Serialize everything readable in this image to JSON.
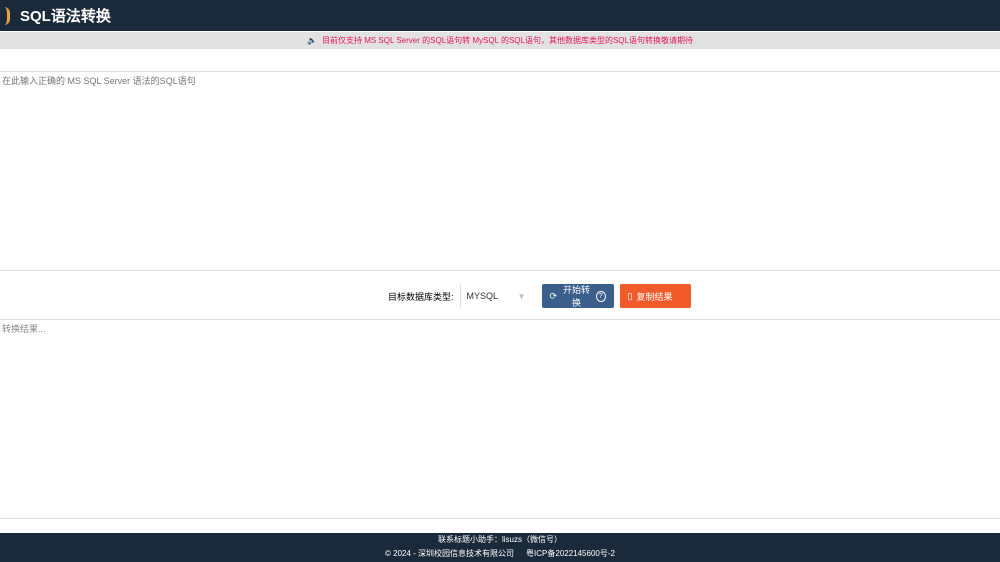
{
  "header": {
    "title": "SQL语法转换"
  },
  "notice": {
    "icon": "speaker-icon",
    "text": "目前仅支持 MS SQL Server 的SQL语句转 MySQL 的SQL语句，其他数据库类型的SQL语句转换敬请期待"
  },
  "input": {
    "placeholder": "在此输入正确的 MS SQL Server 语法的SQL语句",
    "value": ""
  },
  "controls": {
    "label": "目标数据库类型:",
    "selected": "MYSQL",
    "convert": "开始转换",
    "help": "?",
    "copy": "复制结果"
  },
  "output": {
    "placeholder": "转换结果..."
  },
  "footer": {
    "contact": "联系标题小助手：lisuzs（微信号）",
    "copyright": "© 2024 - 深圳校园信息技术有限公司",
    "icp": "粤ICP备2022145600号-2"
  }
}
